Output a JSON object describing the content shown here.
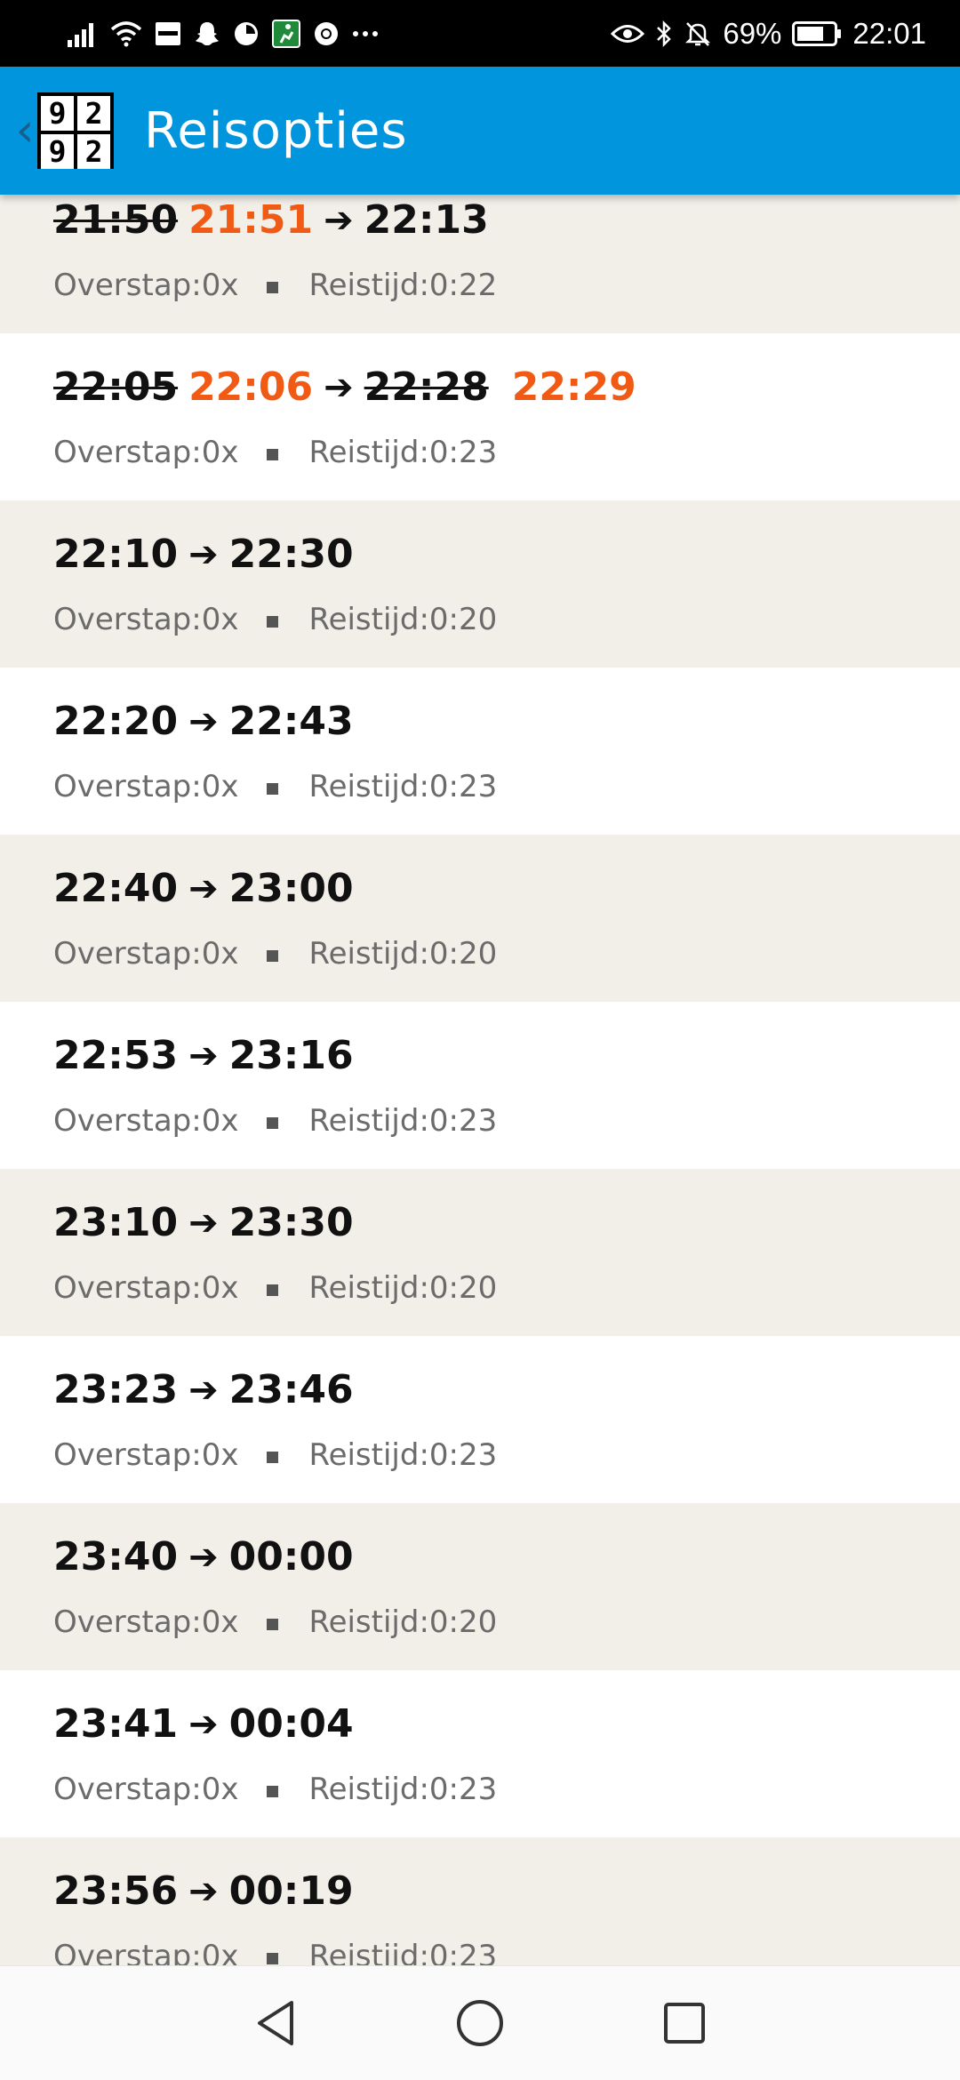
{
  "status_bar": {
    "battery_percent": "69%",
    "time": "22:01",
    "left_icons": [
      "signal-icon",
      "wifi-icon",
      "sonos-icon",
      "snapchat-icon",
      "clock-app-icon",
      "fitness-app-icon",
      "chrome-icon",
      "more-icon"
    ],
    "right_icons": [
      "eye-icon",
      "bluetooth-icon",
      "bell-off-icon",
      "battery-icon"
    ]
  },
  "app_bar": {
    "back_glyph": "‹",
    "logo_digits": [
      "9",
      "2",
      "9",
      "2"
    ],
    "title": "Reisopties",
    "color": "#0095dd"
  },
  "labels": {
    "transfer_prefix": "Overstap:",
    "duration_prefix": "Reistijd:"
  },
  "trips": [
    {
      "dep_old": "21:50",
      "dep": "21:51",
      "arr": "22:13",
      "arr_new": "",
      "transfers": "0x",
      "duration": "0:22"
    },
    {
      "dep_old": "22:05",
      "dep": "22:06",
      "arr_old": "22:28",
      "arr": "",
      "arr_new": "22:29",
      "transfers": "0x",
      "duration": "0:23"
    },
    {
      "dep": "22:10",
      "arr": "22:30",
      "transfers": "0x",
      "duration": "0:20"
    },
    {
      "dep": "22:20",
      "arr": "22:43",
      "transfers": "0x",
      "duration": "0:23"
    },
    {
      "dep": "22:40",
      "arr": "23:00",
      "transfers": "0x",
      "duration": "0:20"
    },
    {
      "dep": "22:53",
      "arr": "23:16",
      "transfers": "0x",
      "duration": "0:23"
    },
    {
      "dep": "23:10",
      "arr": "23:30",
      "transfers": "0x",
      "duration": "0:20"
    },
    {
      "dep": "23:23",
      "arr": "23:46",
      "transfers": "0x",
      "duration": "0:23"
    },
    {
      "dep": "23:40",
      "arr": "00:00",
      "transfers": "0x",
      "duration": "0:20"
    },
    {
      "dep": "23:41",
      "arr": "00:04",
      "transfers": "0x",
      "duration": "0:23"
    },
    {
      "dep": "23:56",
      "arr": "00:19",
      "transfers": "0x",
      "duration": "0:23"
    }
  ],
  "colors": {
    "delay": "#f05a14",
    "row_alt": "#f2eee8",
    "row_plain": "#ffffff"
  },
  "nav_bar": {
    "buttons": [
      "back-triangle-icon",
      "home-circle-icon",
      "recents-square-icon"
    ]
  }
}
